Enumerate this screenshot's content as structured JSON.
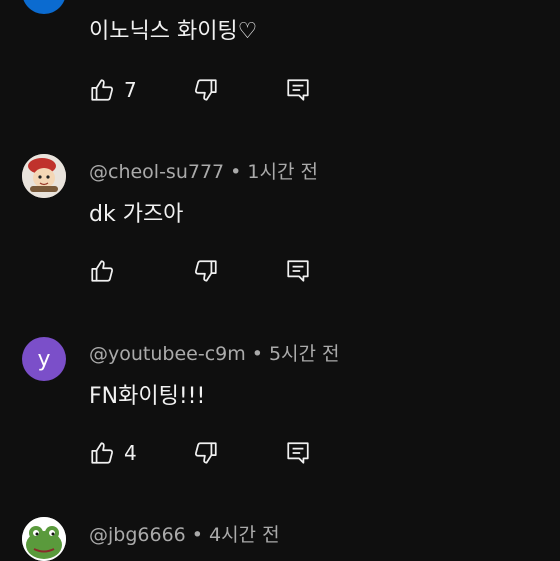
{
  "comments": [
    {
      "author": "",
      "time": "",
      "text": "이노닉스 화이팅♡",
      "likes": "7",
      "avatar_color": "#0b6bd0",
      "avatar_letter": ""
    },
    {
      "author": "@cheol-su777",
      "time": "1시간 전",
      "text": "dk 가즈아",
      "likes": "",
      "avatar_color": "#e9e3dc",
      "avatar_letter": ""
    },
    {
      "author": "@youtubee-c9m",
      "time": "5시간 전",
      "text": "FN화이팅!!!",
      "likes": "4",
      "avatar_color": "#7b4fc9",
      "avatar_letter": "y"
    },
    {
      "author": "@jbg6666",
      "time": "4시간 전",
      "text": "",
      "likes": "",
      "avatar_color": "#ffffff",
      "avatar_letter": ""
    }
  ],
  "separator": "•",
  "icons": {
    "like": "thumbs-up-icon",
    "dislike": "thumbs-down-icon",
    "reply": "reply-comment-icon"
  }
}
